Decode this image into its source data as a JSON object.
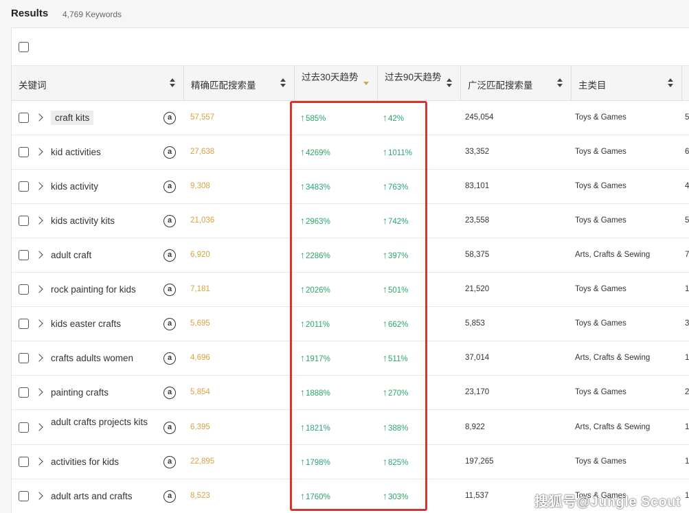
{
  "results": {
    "title": "Results",
    "count": "4,769 Keywords"
  },
  "columns": [
    {
      "label": "关键词"
    },
    {
      "label": "精确匹配搜索量"
    },
    {
      "label": "过去30天趋势"
    },
    {
      "label": "过去90天趋势"
    },
    {
      "label": "广泛匹配搜索量"
    },
    {
      "label": "主类目"
    }
  ],
  "icons": {
    "sort": "sort-icon",
    "amazon": "amazon-icon",
    "expand": "chevron-right-icon",
    "trend": "arrow-up-icon"
  },
  "amazon_glyph": "a",
  "trend_arrow": "↑",
  "colors": {
    "exact": "#d6a33f",
    "trend": "#2aa56d",
    "highlight": "#d7342f"
  },
  "rows": [
    {
      "keyword": "craft kits",
      "exact": "57,557",
      "t30": "585%",
      "t90": "42%",
      "broad": "245,054",
      "category": "Toys & Games",
      "edge": "5"
    },
    {
      "keyword": "kid activities",
      "exact": "27,638",
      "t30": "4269%",
      "t90": "1011%",
      "broad": "33,352",
      "category": "Toys & Games",
      "edge": "6"
    },
    {
      "keyword": "kids activity",
      "exact": "9,308",
      "t30": "3483%",
      "t90": "763%",
      "broad": "83,101",
      "category": "Toys & Games",
      "edge": "4"
    },
    {
      "keyword": "kids activity kits",
      "exact": "21,036",
      "t30": "2963%",
      "t90": "742%",
      "broad": "23,558",
      "category": "Toys & Games",
      "edge": "5"
    },
    {
      "keyword": "adult craft",
      "exact": "6,920",
      "t30": "2286%",
      "t90": "397%",
      "broad": "58,375",
      "category": "Arts, Crafts & Sewing",
      "edge": "7"
    },
    {
      "keyword": "rock painting for kids",
      "exact": "7,181",
      "t30": "2026%",
      "t90": "501%",
      "broad": "21,520",
      "category": "Toys & Games",
      "edge": "1"
    },
    {
      "keyword": "kids easter crafts",
      "exact": "5,695",
      "t30": "2011%",
      "t90": "662%",
      "broad": "5,853",
      "category": "Toys & Games",
      "edge": "3"
    },
    {
      "keyword": "crafts adults women",
      "exact": "4,696",
      "t30": "1917%",
      "t90": "511%",
      "broad": "37,014",
      "category": "Arts, Crafts & Sewing",
      "edge": "1"
    },
    {
      "keyword": "painting crafts",
      "exact": "5,854",
      "t30": "1888%",
      "t90": "270%",
      "broad": "23,170",
      "category": "Toys & Games",
      "edge": "2"
    },
    {
      "keyword": "adult crafts projects kits",
      "exact": "6,395",
      "t30": "1821%",
      "t90": "388%",
      "broad": "8,922",
      "category": "Arts, Crafts & Sewing",
      "edge": "1"
    },
    {
      "keyword": "activities for kids",
      "exact": "22,895",
      "t30": "1798%",
      "t90": "825%",
      "broad": "197,265",
      "category": "Toys & Games",
      "edge": "1"
    },
    {
      "keyword": "adult arts and crafts",
      "exact": "8,523",
      "t30": "1760%",
      "t90": "303%",
      "broad": "11,537",
      "category": "Toys & Games",
      "edge": "1"
    }
  ],
  "watermark": "搜狐号@Jungle Scout"
}
